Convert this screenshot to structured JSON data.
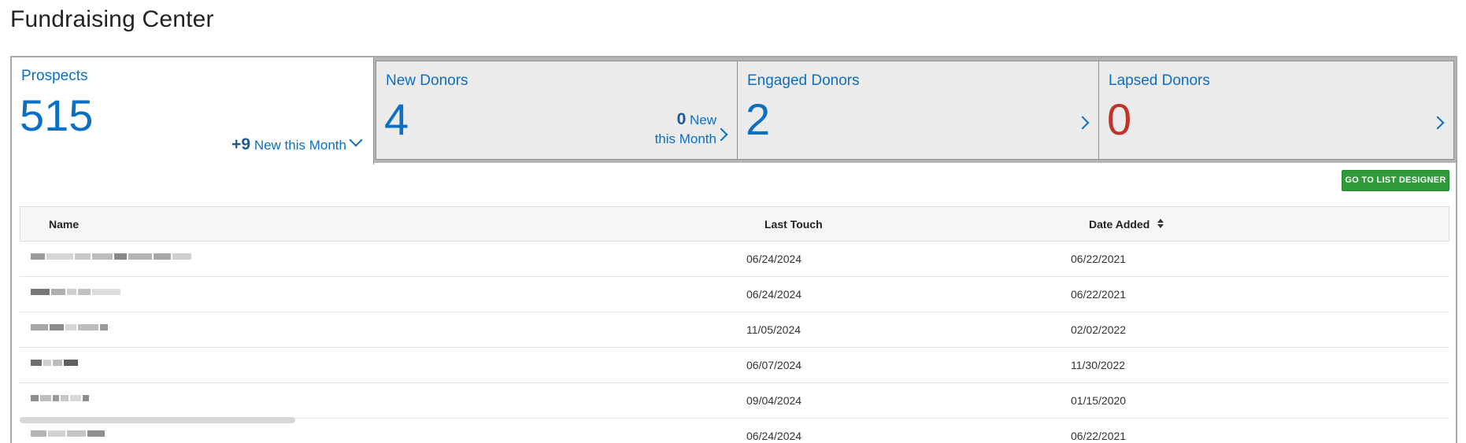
{
  "page": {
    "title": "Fundraising Center"
  },
  "tabs": [
    {
      "title": "Prospects",
      "count": "515",
      "delta": "+9",
      "delta_label": "New this Month"
    },
    {
      "title": "New Donors",
      "count": "4",
      "delta": "0",
      "delta_label_1": "New",
      "delta_label_2": "this Month"
    },
    {
      "title": "Engaged Donors",
      "count": "2"
    },
    {
      "title": "Lapsed Donors",
      "count": "0"
    }
  ],
  "colors": {
    "accent": "#0b6fc4",
    "negative": "#c0332d",
    "button": "#2e9a3a"
  },
  "actions": {
    "list_designer": "GO TO LIST DESIGNER"
  },
  "table": {
    "columns": [
      "Name",
      "Last Touch",
      "Date Added"
    ],
    "rows": [
      {
        "last_touch": "06/24/2024",
        "date_added": "06/22/2021"
      },
      {
        "last_touch": "06/24/2024",
        "date_added": "06/22/2021"
      },
      {
        "last_touch": "11/05/2024",
        "date_added": "02/02/2022"
      },
      {
        "last_touch": "06/07/2024",
        "date_added": "11/30/2022"
      },
      {
        "last_touch": "09/04/2024",
        "date_added": "01/15/2020"
      },
      {
        "last_touch": "06/24/2024",
        "date_added": "06/22/2021"
      }
    ]
  }
}
